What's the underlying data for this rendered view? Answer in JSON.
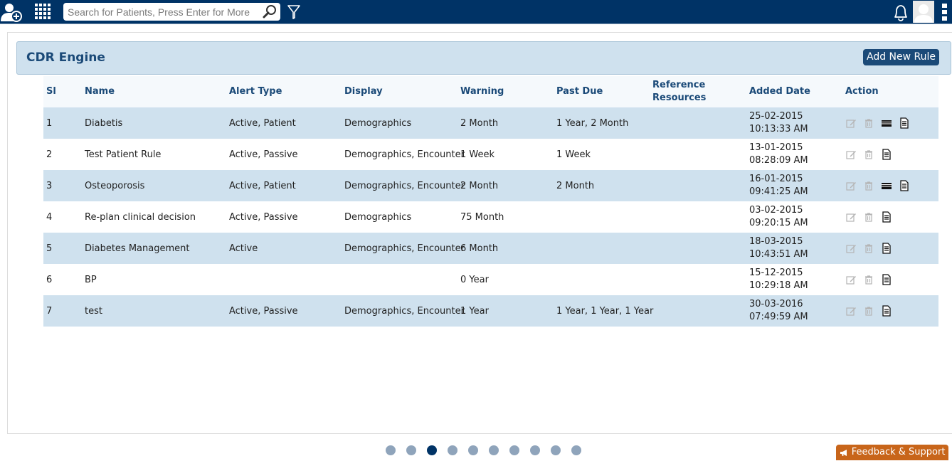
{
  "topbar": {
    "search_placeholder": "Search for Patients, Press Enter for More",
    "icons": [
      "add-patient-icon",
      "apps-grid-icon",
      "search-icon",
      "filter-icon",
      "bell-icon",
      "avatar",
      "kebab-menu-icon"
    ]
  },
  "panel": {
    "title": "CDR Engine",
    "add_rule_label": "Add New Rule"
  },
  "table": {
    "columns": {
      "sl": "Sl",
      "name": "Name",
      "alert_type": "Alert Type",
      "display": "Display",
      "warning": "Warning",
      "past_due": "Past Due",
      "reference_line1": "Reference",
      "reference_line2": "Resources",
      "added_date": "Added Date",
      "action": "Action"
    },
    "rows": [
      {
        "sl": "1",
        "name": "Diabetis",
        "alert_type": "Active, Patient",
        "display": "Demographics",
        "warning": "2 Month",
        "past_due": "1 Year, 2 Month",
        "reference": "",
        "added_date": "25-02-2015 10:13:33 AM",
        "has_ref_icon": true
      },
      {
        "sl": "2",
        "name": "Test Patient Rule",
        "alert_type": "Active, Passive",
        "display": "Demographics, Encounter",
        "warning": "1 Week",
        "past_due": "1 Week",
        "reference": "",
        "added_date": "13-01-2015 08:28:09 AM",
        "has_ref_icon": false
      },
      {
        "sl": "3",
        "name": "Osteoporosis",
        "alert_type": "Active, Patient",
        "display": "Demographics, Encounter",
        "warning": "2 Month",
        "past_due": "2 Month",
        "reference": "",
        "added_date": "16-01-2015 09:41:25 AM",
        "has_ref_icon": true
      },
      {
        "sl": "4",
        "name": "Re-plan clinical decision",
        "alert_type": "Active, Passive",
        "display": "Demographics",
        "warning": "75 Month",
        "past_due": "",
        "reference": "",
        "added_date": "03-02-2015 09:20:15 AM",
        "has_ref_icon": false
      },
      {
        "sl": "5",
        "name": "Diabetes Management",
        "alert_type": "Active",
        "display": "Demographics, Encounter",
        "warning": "6 Month",
        "past_due": "",
        "reference": "",
        "added_date": "18-03-2015 10:43:51 AM",
        "has_ref_icon": false
      },
      {
        "sl": "6",
        "name": "BP",
        "alert_type": "",
        "display": "",
        "warning": "0 Year",
        "past_due": "",
        "reference": "",
        "added_date": "15-12-2015 10:29:18 AM",
        "has_ref_icon": false
      },
      {
        "sl": "7",
        "name": "test",
        "alert_type": "Active, Passive",
        "display": "Demographics, Encounter",
        "warning": "1 Year",
        "past_due": "1 Year, 1 Year, 1 Year",
        "reference": "",
        "added_date": "30-03-2016 07:49:59 AM",
        "has_ref_icon": false
      }
    ]
  },
  "pager": {
    "page_count": 10,
    "active_index": 2
  },
  "feedback": {
    "label": "Feedback & Support"
  },
  "colors": {
    "topbar": "#003366",
    "accent": "#1b4a78",
    "row_alt": "#cfe1ee",
    "feedback": "#c8651a"
  }
}
